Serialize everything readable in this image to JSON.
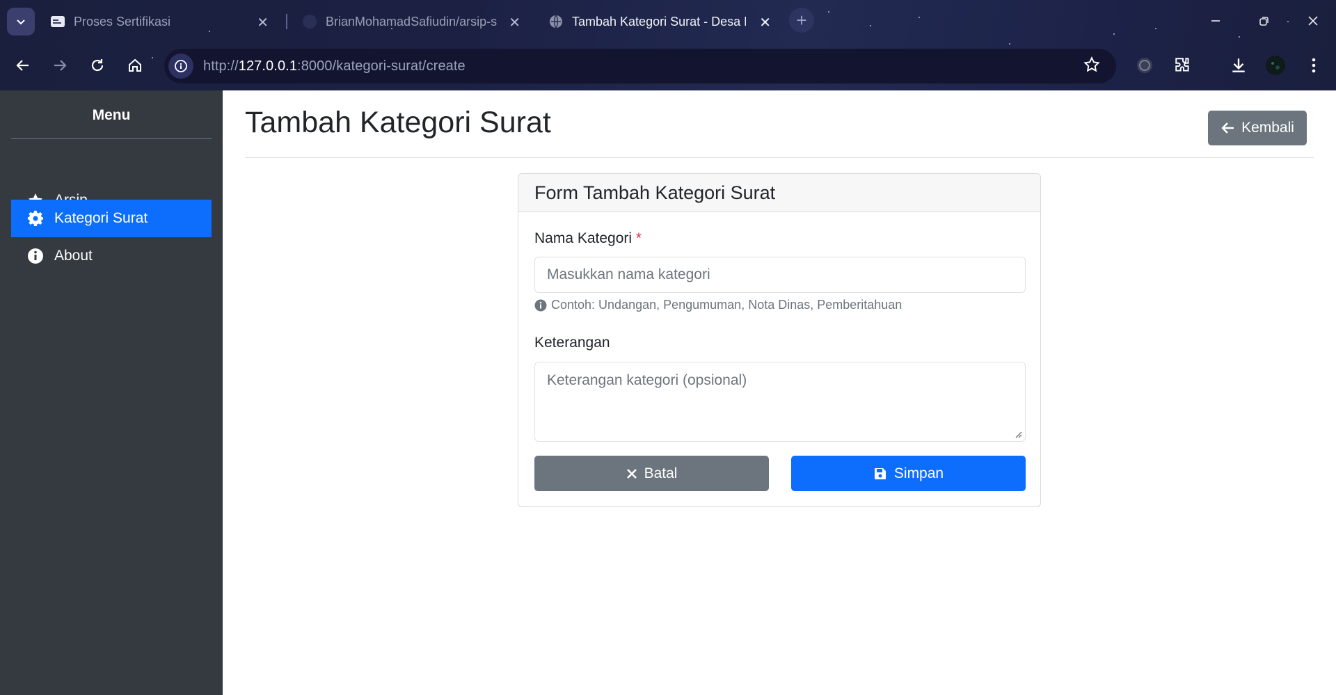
{
  "browser": {
    "tabs": [
      {
        "title": "Proses Sertifikasi",
        "active": false
      },
      {
        "title": "BrianMohamadSafiudin/arsip-s",
        "active": false
      },
      {
        "title": "Tambah Kategori Surat - Desa K",
        "active": true
      }
    ],
    "url_prefix": "http://",
    "url_host": "127.0.0.1",
    "url_path": ":8000/kategori-surat/create"
  },
  "sidebar": {
    "title": "Menu",
    "items": [
      {
        "label": "Arsip",
        "icon": "star-icon",
        "active": false
      },
      {
        "label": "Kategori Surat",
        "icon": "gear-icon",
        "active": true
      },
      {
        "label": "About",
        "icon": "info-circle-icon",
        "active": false
      }
    ]
  },
  "main": {
    "title": "Tambah Kategori Surat",
    "back_label": "Kembali"
  },
  "form": {
    "header": "Form Tambah Kategori Surat",
    "name_label": "Nama Kategori",
    "required_mark": "*",
    "name_placeholder": "Masukkan nama kategori",
    "name_hint": "Contoh: Undangan, Pengumuman, Nota Dinas, Pemberitahuan",
    "desc_label": "Keterangan",
    "desc_placeholder": "Keterangan kategori (opsional)",
    "cancel_label": "Batal",
    "save_label": "Simpan"
  },
  "colors": {
    "primary": "#0d6efd",
    "secondary": "#6c757d",
    "sidebar": "#343a40",
    "danger": "#dc3545"
  }
}
